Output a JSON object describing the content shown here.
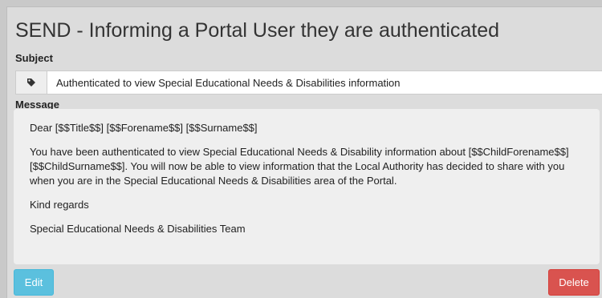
{
  "page": {
    "title": "SEND - Informing a Portal User they are authenticated"
  },
  "subject": {
    "label": "Subject",
    "icon": "tag-icon",
    "value": "Authenticated to view Special Educational Needs & Disabilities information"
  },
  "message": {
    "label": "Message",
    "paragraphs": [
      "Dear [$$Title$$] [$$Forename$$] [$$Surname$$]",
      "You have been authenticated to view Special Educational Needs & Disability information about [$$ChildForename$$] [$$ChildSurname$$]. You will now be able to view information that the Local Authority has decided to share with you when you are in the Special Educational Needs & Disabilities area of the Portal.",
      "Kind regards",
      "Special Educational Needs & Disabilities Team"
    ]
  },
  "actions": {
    "edit_label": "Edit",
    "delete_label": "Delete"
  },
  "colors": {
    "edit": "#5bc0de",
    "delete": "#d9534f"
  }
}
